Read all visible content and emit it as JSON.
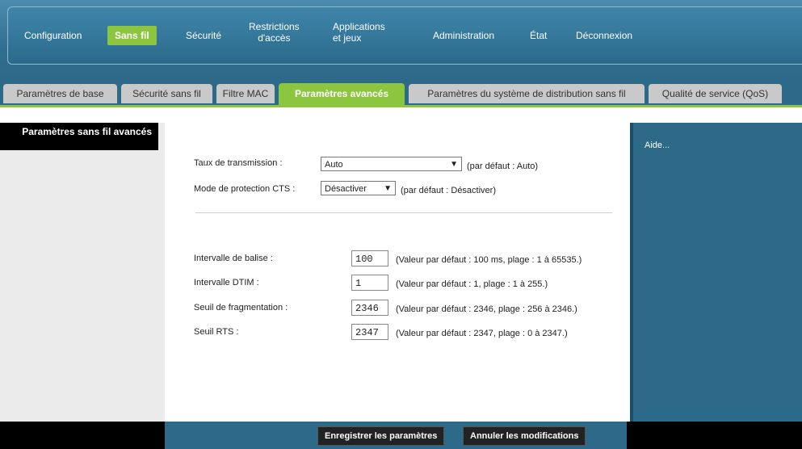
{
  "top_menu": [
    {
      "label": "Configuration"
    },
    {
      "label": "Sans fil"
    },
    {
      "label": "Sécurité"
    },
    {
      "label": "Restrictions\nd'accès"
    },
    {
      "label": "Applications\net jeux"
    },
    {
      "label": "Administration"
    },
    {
      "label": "État"
    },
    {
      "label": "Déconnexion"
    }
  ],
  "sub_tabs": [
    {
      "label": "Paramètres de base"
    },
    {
      "label": "Sécurité sans fil"
    },
    {
      "label": "Filtre MAC"
    },
    {
      "label": "Paramètres avancés"
    },
    {
      "label": "Paramètres du système de distribution sans fil"
    },
    {
      "label": "Qualité de service (QoS)"
    }
  ],
  "left_nav": {
    "title": "Paramètres sans fil avancés"
  },
  "form": {
    "tx_rate": {
      "label": "Taux de transmission :",
      "value": "Auto",
      "hint": "(par défaut : Auto)"
    },
    "cts": {
      "label": "Mode de protection CTS :",
      "value": "Désactiver",
      "hint": "(par défaut : Désactiver)"
    },
    "beacon": {
      "label": "Intervalle de balise :",
      "value": "100",
      "hint": "(Valeur par défaut : 100 ms, plage : 1 à 65535.)"
    },
    "dtim": {
      "label": "Intervalle DTIM :",
      "value": "1",
      "hint": "(Valeur par défaut : 1, plage : 1 à 255.)"
    },
    "frag": {
      "label": "Seuil de fragmentation :",
      "value": "2346",
      "hint": "(Valeur par défaut : 2346, plage : 256 à 2346.)"
    },
    "rts": {
      "label": "Seuil RTS :",
      "value": "2347",
      "hint": "(Valeur par défaut : 2347, plage : 0 à 2347.)"
    }
  },
  "help": {
    "title": "Aide..."
  },
  "buttons": {
    "save": "Enregistrer les paramètres",
    "cancel": "Annuler les modifications"
  },
  "colors": {
    "accent": "#8cc63f",
    "primary": "#2d6a8a"
  }
}
